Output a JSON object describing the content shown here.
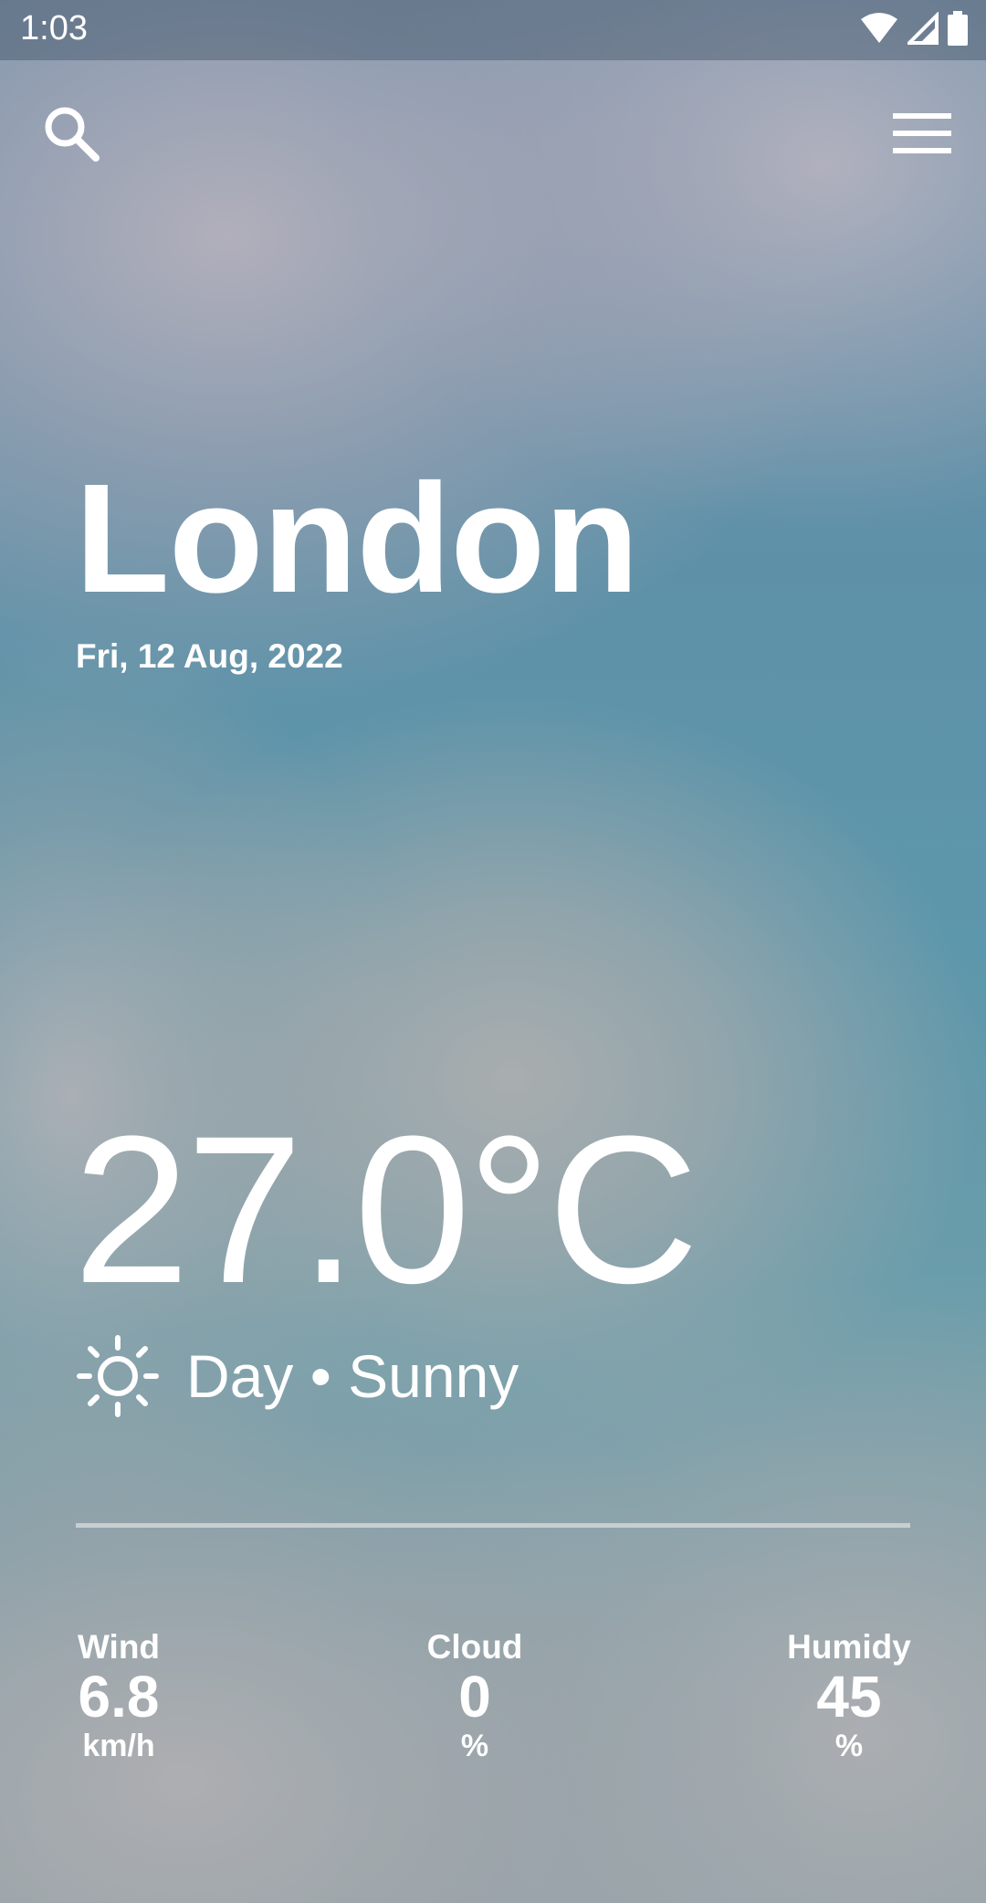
{
  "status_bar": {
    "time": "1:03"
  },
  "toolbar": {
    "search_icon": "search-icon",
    "menu_icon": "menu-icon"
  },
  "location": {
    "city": "London",
    "date": "Fri, 12 Aug, 2022"
  },
  "current": {
    "temperature": "27.0°C",
    "condition_icon": "sun-icon",
    "condition": "Day • Sunny"
  },
  "stats": {
    "wind": {
      "label": "Wind",
      "value": "6.8",
      "unit": "km/h"
    },
    "cloud": {
      "label": "Cloud",
      "value": "0",
      "unit": "%"
    },
    "humidity": {
      "label": "Humidy",
      "value": "45",
      "unit": "%"
    }
  },
  "colors": {
    "text": "#ffffff",
    "sky": "#5e91a8"
  }
}
